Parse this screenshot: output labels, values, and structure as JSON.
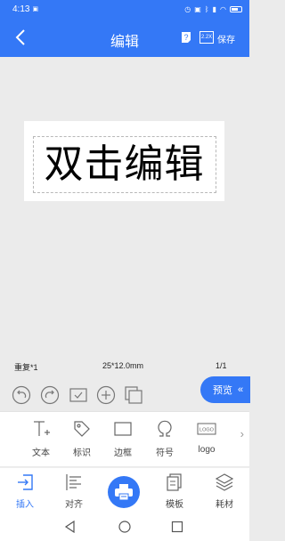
{
  "status_bar": {
    "time": "4:13",
    "recording_badge": "▣"
  },
  "header": {
    "title": "编辑",
    "zoom_icon_text": "2.2X",
    "save_label": "保存"
  },
  "canvas": {
    "label_text": "双击编辑"
  },
  "label_info": {
    "repeat": "重复*1",
    "size": "25*12.0mm",
    "page": "1/1"
  },
  "edit_toolbar": {
    "icons": [
      "undo-icon",
      "redo-icon",
      "checkbox-icon",
      "add-icon",
      "copy-icon"
    ]
  },
  "preview": {
    "label": "预览",
    "arrow": "«"
  },
  "insert_items": [
    {
      "label": "文本",
      "icon": "text-icon"
    },
    {
      "label": "标识",
      "icon": "tag-icon"
    },
    {
      "label": "边框",
      "icon": "border-icon"
    },
    {
      "label": "符号",
      "icon": "symbol-icon"
    },
    {
      "label": "logo",
      "icon": "logo-icon",
      "icon_text": "LOGO"
    }
  ],
  "more_arrow": "›",
  "tabs": [
    {
      "label": "插入",
      "icon": "insert-icon",
      "active": true
    },
    {
      "label": "对齐",
      "icon": "align-icon",
      "active": false
    },
    {
      "label": "模板",
      "icon": "template-icon",
      "active": false
    },
    {
      "label": "耗材",
      "icon": "consumables-icon",
      "active": false
    }
  ],
  "colors": {
    "accent": "#3478f6",
    "background": "#ebebeb"
  }
}
